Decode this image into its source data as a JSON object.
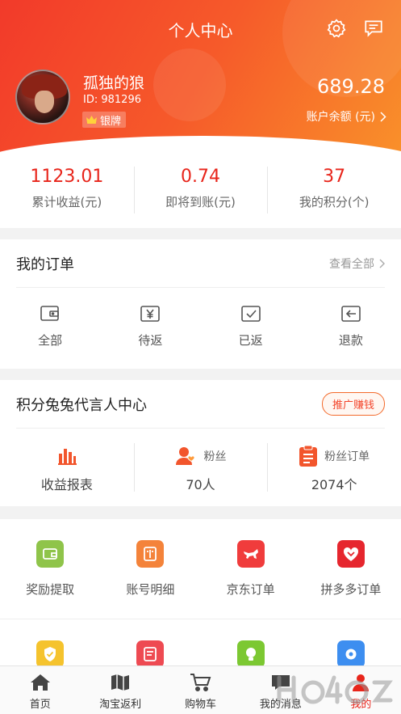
{
  "header": {
    "title": "个人中心",
    "username": "孤独的狼",
    "user_id": "ID: 981296",
    "badge": "银牌",
    "balance": "689.28",
    "balance_label": "账户余额 (元)"
  },
  "stats": [
    {
      "value": "1123.01",
      "label": "累计收益(元)"
    },
    {
      "value": "0.74",
      "label": "即将到账(元)"
    },
    {
      "value": "37",
      "label": "我的积分(个)"
    }
  ],
  "orders": {
    "title": "我的订单",
    "more": "查看全部",
    "items": [
      {
        "label": "全部",
        "icon": "wallet-icon"
      },
      {
        "label": "待返",
        "icon": "yen-check-icon"
      },
      {
        "label": "已返",
        "icon": "check-box-icon"
      },
      {
        "label": "退款",
        "icon": "return-icon"
      }
    ]
  },
  "agent": {
    "title": "积分兔兔代言人中心",
    "promo": "推广赚钱",
    "report": "收益报表",
    "fans_label": "粉丝",
    "fans_value": "70人",
    "fan_orders_label": "粉丝订单",
    "fan_orders_value": "2074个"
  },
  "tools": [
    {
      "label": "奖励提取",
      "color": "#8fc44a"
    },
    {
      "label": "账号明细",
      "color": "#f4833a"
    },
    {
      "label": "京东订单",
      "color": "#f03c3c"
    },
    {
      "label": "拼多多订单",
      "color": "#e6262e"
    }
  ],
  "tools_row2_colors": [
    "#f5c32d",
    "#ee4a52",
    "#7cc832",
    "#3d8ef0"
  ],
  "tabbar": [
    {
      "label": "首页"
    },
    {
      "label": "淘宝返利"
    },
    {
      "label": "购物车"
    },
    {
      "label": "我的消息"
    },
    {
      "label": "我的"
    }
  ],
  "colors": {
    "accent": "#e8251b",
    "header_start": "#f23a2a",
    "header_end": "#f9902a"
  }
}
